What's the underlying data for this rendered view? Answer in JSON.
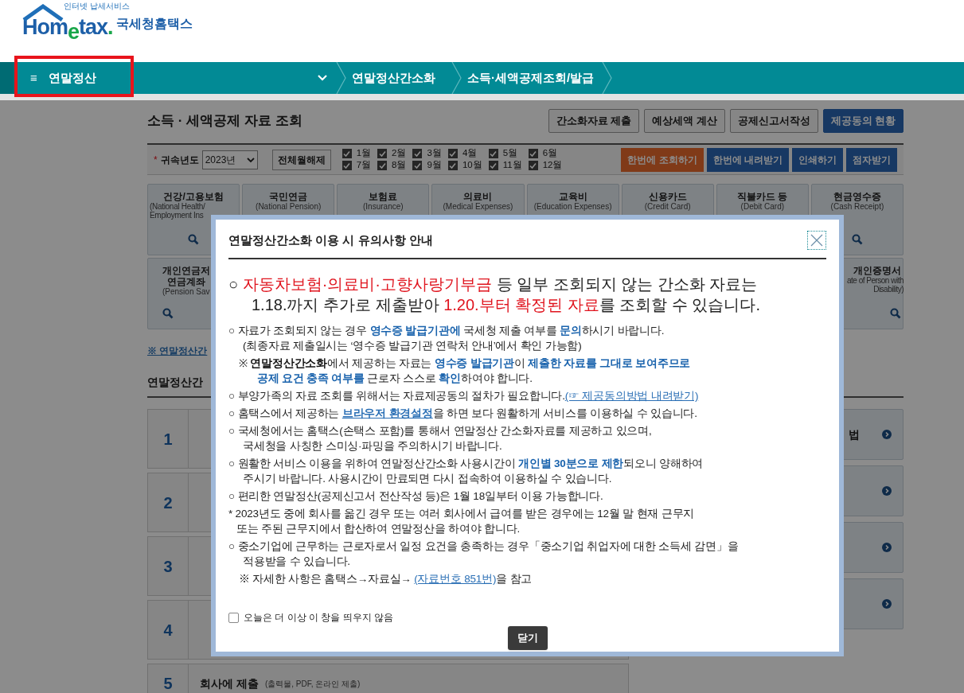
{
  "logo": {
    "tagline": "인터넷 납세서비스",
    "wordmark_a": "Hom",
    "wordmark_e": "e",
    "wordmark_b": "tax",
    "wordmark_dot": ".",
    "name": "국세청홈택스"
  },
  "nav": {
    "menu_icon": "≡",
    "menu_label": "연말정산",
    "breadcrumbs": [
      "연말정산간소화",
      "소득·세액공제조회/발급"
    ]
  },
  "page_title": "소득 · 세액공제 자료 조회",
  "top_buttons": [
    {
      "label": "간소화자료 제출",
      "kind": "plain"
    },
    {
      "label": "예상세액 계산",
      "kind": "plain"
    },
    {
      "label": "공제신고서작성",
      "kind": "plain"
    },
    {
      "label": "제공동의 현황",
      "kind": "primary"
    }
  ],
  "filter": {
    "required_mark": "*",
    "year_label": "귀속년도",
    "year_value": "2023년",
    "clear_button": "전체월해제",
    "months": [
      {
        "label": "1월",
        "checked": true
      },
      {
        "label": "2월",
        "checked": true
      },
      {
        "label": "3월",
        "checked": true
      },
      {
        "label": "4월",
        "checked": true
      },
      {
        "label": "5월",
        "checked": true
      },
      {
        "label": "6월",
        "checked": true
      },
      {
        "label": "7월",
        "checked": true
      },
      {
        "label": "8월",
        "checked": true
      },
      {
        "label": "9월",
        "checked": true
      },
      {
        "label": "10월",
        "checked": true
      },
      {
        "label": "11월",
        "checked": true
      },
      {
        "label": "12월",
        "checked": true
      }
    ],
    "actions": [
      {
        "label": "한번에 조회하기",
        "kind": "accent"
      },
      {
        "label": "한번에 내려받기",
        "kind": "primary"
      },
      {
        "label": "인쇄하기",
        "kind": "primary"
      },
      {
        "label": "점자받기",
        "kind": "primary"
      }
    ]
  },
  "categories": [
    {
      "title": "건강/고용보험",
      "subtitle": "(National Health/ Employment Ins",
      "kind": "cut"
    },
    {
      "title": "국민연금",
      "subtitle": "(National Pension)"
    },
    {
      "title": "보험료",
      "subtitle": "(Insurance)"
    },
    {
      "title": "의료비",
      "subtitle": "(Medical Expenses)"
    },
    {
      "title": "교육비",
      "subtitle": "(Education Expenses)"
    },
    {
      "title": "신용카드",
      "subtitle": "(Credit Card)"
    },
    {
      "title": "직불카드 등",
      "subtitle": "(Debit Card)"
    },
    {
      "title": "현금영수증",
      "subtitle": "(Cash Receipt)"
    }
  ],
  "categories_row2": [
    {
      "title": "개인연금저\n연금계좌",
      "subtitle": "(Pension Sav",
      "kind": "cut_right"
    },
    {
      "title": "개인증명서",
      "subtitle": "ate of Person with\nDisability)",
      "kind": "cut_left"
    }
  ],
  "notice_link": "※ 연말정산간",
  "section_title": "연말정산간",
  "steps": [
    {
      "number": "1"
    },
    {
      "number": "2"
    },
    {
      "number": "3"
    },
    {
      "number": "4"
    },
    {
      "number": "5",
      "title": "회사에 제출",
      "note": "(출력물, PDF, 온라인 제출)"
    }
  ],
  "side_links": [
    {
      "kind": "labeled",
      "label": "법"
    },
    {
      "kind": "blank"
    },
    {
      "kind": "blank"
    },
    {
      "kind": "blank"
    }
  ],
  "modal": {
    "title": "연말정산간소화 이용 시 유의사항 안내",
    "headline": [
      [
        {
          "text": "○ ",
          "kind": "plain"
        },
        {
          "text": "자동차보험·의료비·고향사랑기부금",
          "kind": "red"
        },
        {
          "text": " 등 일부 조회되지 않는 간소화 자료는",
          "kind": "plain"
        }
      ],
      [
        {
          "text": "1.18.까지 추가로 제출받아 ",
          "kind": "plain"
        },
        {
          "text": "1.20.부터 확정된 자료",
          "kind": "red"
        },
        {
          "text": "를 조회할 수 있습니다.",
          "kind": "plain"
        }
      ]
    ],
    "paragraphs": [
      {
        "kind": "bullet",
        "lines": [
          [
            {
              "text": "○  자료가 조회되지 않는 경우 ",
              "kind": "plain"
            },
            {
              "text": "영수증 발급기관에",
              "kind": "blue"
            },
            {
              "text": " 국세청 제출 여부를 ",
              "kind": "plain"
            },
            {
              "text": "문의",
              "kind": "blue"
            },
            {
              "text": "하시기 바랍니다.",
              "kind": "plain"
            }
          ],
          [
            {
              "text": "(최종자료 제출일시는 ‘영수증 발급기관 연락처 안내’에서 확인 가능함)",
              "kind": "plain"
            }
          ]
        ]
      },
      {
        "kind": "note",
        "lines": [
          [
            {
              "text": "※ ",
              "kind": "plain"
            },
            {
              "text": "연말정산간소화",
              "kind": "bold"
            },
            {
              "text": "에서 제공하는 자료는 ",
              "kind": "plain"
            },
            {
              "text": "영수증 발급기관",
              "kind": "blue"
            },
            {
              "text": "이 ",
              "kind": "plain"
            },
            {
              "text": "제출한 자료를 그대로 보여주므로",
              "kind": "blue"
            }
          ],
          [
            {
              "text": "공제 요건 충족 여부를",
              "kind": "blue"
            },
            {
              "text": " 근로자 스스로 ",
              "kind": "plain"
            },
            {
              "text": "확인",
              "kind": "blue"
            },
            {
              "text": "하여야 합니다.",
              "kind": "plain"
            }
          ]
        ]
      },
      {
        "kind": "bullet",
        "lines": [
          [
            {
              "text": "○ 부양가족의 자료 조회를 위해서는 자료제공동의 절차가 필요합니다.",
              "kind": "plain"
            },
            {
              "text": "(☞ 제공동의방법 내려받기)",
              "kind": "link"
            }
          ]
        ]
      },
      {
        "kind": "bullet",
        "lines": [
          [
            {
              "text": "○ 홈택스에서 제공하는 ",
              "kind": "plain"
            },
            {
              "text": "브라우저 환경설정",
              "kind": "linkbold"
            },
            {
              "text": "을 하면 보다 원활하게 서비스를 이용하실 수 있습니다.",
              "kind": "plain"
            }
          ]
        ]
      },
      {
        "kind": "bullet",
        "lines": [
          [
            {
              "text": "○ 국세청에서는 홈택스(손택스 포함)를 통해서 연말정산 간소화자료를 제공하고 있으며,",
              "kind": "plain"
            }
          ],
          [
            {
              "text": "국세청을 사칭한 스미싱·파밍을 주의하시기 바랍니다.",
              "kind": "plain"
            }
          ]
        ]
      },
      {
        "kind": "bullet",
        "lines": [
          [
            {
              "text": "○ 원활한 서비스 이용을 위하여 연말정산간소화 사용시간이 ",
              "kind": "plain"
            },
            {
              "text": "개인별 30분으로 제한",
              "kind": "blue"
            },
            {
              "text": "되오니 양해하여",
              "kind": "plain"
            }
          ],
          [
            {
              "text": "주시기 바랍니다. 사용시간이 만료되면 다시 접속하여 이용하실 수 있습니다.",
              "kind": "plain"
            }
          ]
        ]
      },
      {
        "kind": "bullet",
        "lines": [
          [
            {
              "text": "○ 편리한 연말정산(공제신고서 전산작성 등)은 1월 18일부터 이용 가능합니다.",
              "kind": "plain"
            }
          ]
        ]
      },
      {
        "kind": "asterisk",
        "lines": [
          [
            {
              "text": "* 2023년도 중에 회사를 옮긴 경우 또는 여러 회사에서 급여를 받은 경우에는 12월 말 현재 근무지",
              "kind": "plain"
            }
          ],
          [
            {
              "text": "또는 주된 근무지에서 합산하여 연말정산을 하여야 합니다.",
              "kind": "plain"
            }
          ]
        ]
      },
      {
        "kind": "bullet",
        "lines": [
          [
            {
              "text": "○ 중소기업에 근무하는 근로자로서 일정 요건을 충족하는 경우「중소기업 취업자에 대한 소득세 감면」을",
              "kind": "plain"
            }
          ],
          [
            {
              "text": "적용받을 수 있습니다.",
              "kind": "plain"
            }
          ]
        ]
      },
      {
        "kind": "note",
        "lines": [
          [
            {
              "text": "※ 자세한 사항은 홈택스→자료실→ ",
              "kind": "plain"
            },
            {
              "text": "(자료번호 851번)",
              "kind": "link"
            },
            {
              "text": "을 참고",
              "kind": "plain"
            }
          ]
        ]
      }
    ],
    "dont_show": {
      "label": "오늘은 더 이상 이 창을 띄우지 않음",
      "checked": false
    },
    "close_button": "닫기"
  }
}
